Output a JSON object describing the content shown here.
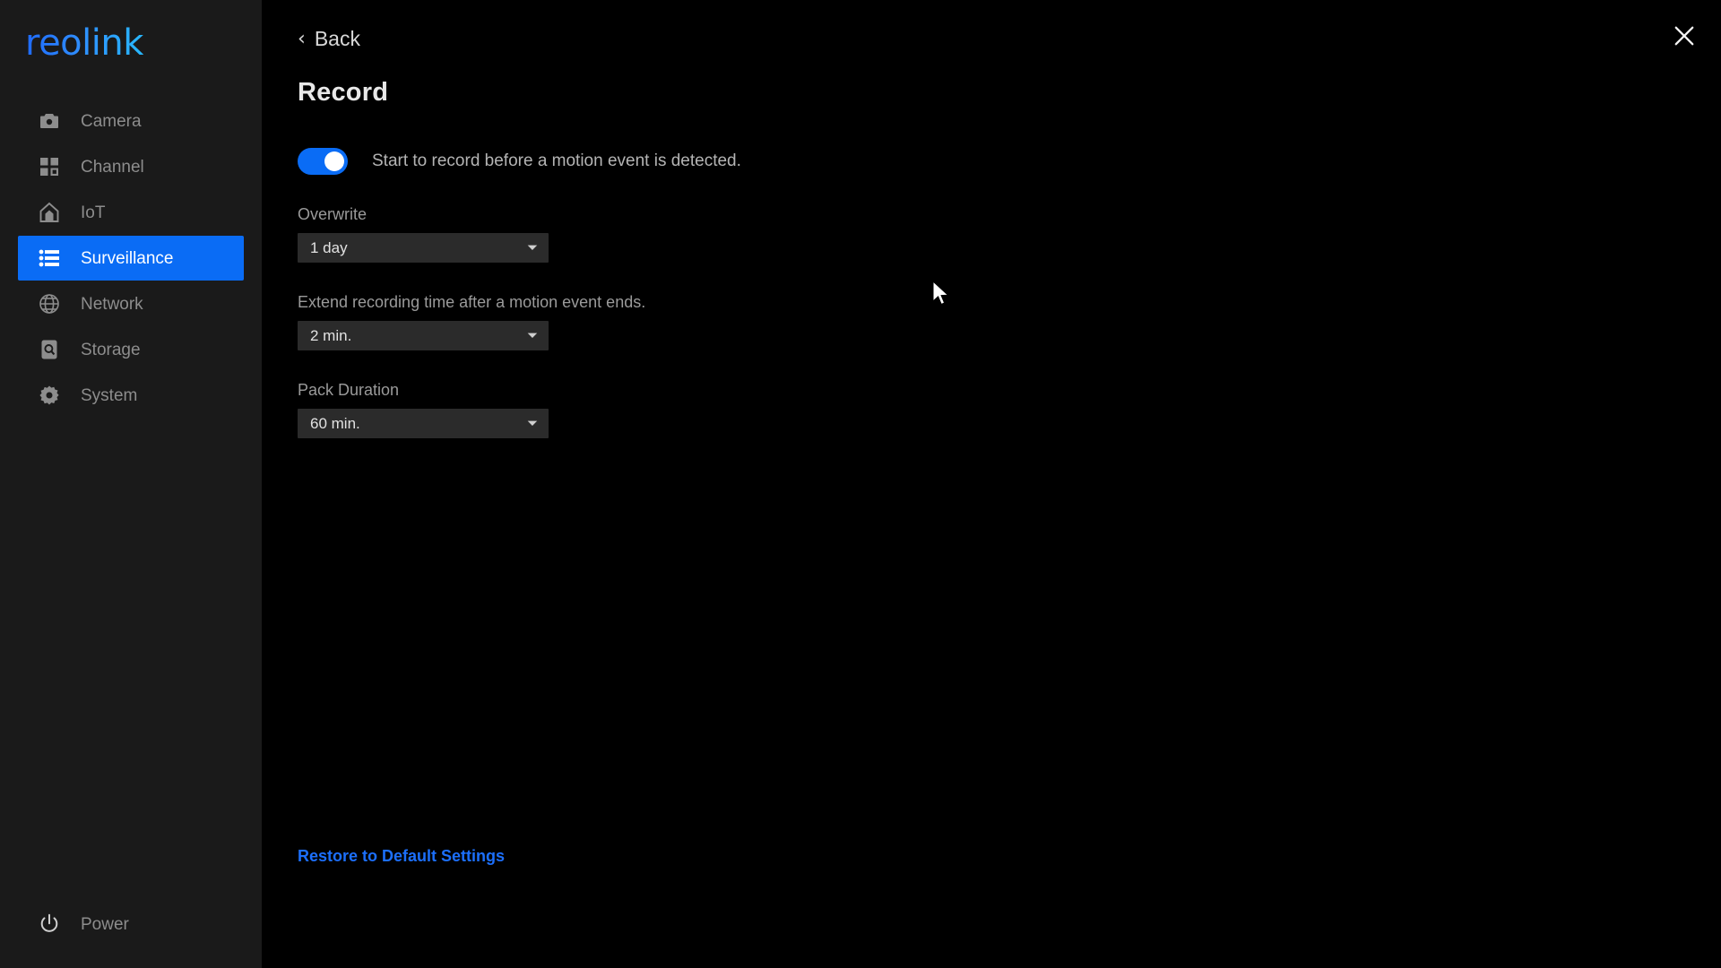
{
  "brand": {
    "logo_text": "reolink"
  },
  "sidebar": {
    "items": [
      {
        "label": "Camera",
        "icon": "camera-icon",
        "active": false
      },
      {
        "label": "Channel",
        "icon": "grid-icon",
        "active": false
      },
      {
        "label": "IoT",
        "icon": "home-icon",
        "active": false
      },
      {
        "label": "Surveillance",
        "icon": "list-icon",
        "active": true
      },
      {
        "label": "Network",
        "icon": "globe-icon",
        "active": false
      },
      {
        "label": "Storage",
        "icon": "harddrive-icon",
        "active": false
      },
      {
        "label": "System",
        "icon": "gear-icon",
        "active": false
      }
    ],
    "power": {
      "label": "Power",
      "icon": "power-icon"
    }
  },
  "header": {
    "back_label": "Back",
    "back_icon": "chevron-left-icon",
    "close_icon": "close-icon",
    "title": "Record"
  },
  "main": {
    "pre_record_toggle": {
      "label": "Start to record before a motion event is detected.",
      "enabled": true
    },
    "fields": [
      {
        "label": "Overwrite",
        "value": "1 day",
        "icon": "chevron-down-icon"
      },
      {
        "label": "Extend recording time after a motion event ends.",
        "value": "2 min.",
        "icon": "chevron-down-icon"
      },
      {
        "label": "Pack Duration",
        "value": "60 min.",
        "icon": "chevron-down-icon"
      }
    ],
    "restore_link": "Restore to Default Settings"
  },
  "colors": {
    "accent": "#0a6cf5",
    "link": "#1c6ffb",
    "sidebar_bg": "#1a1a1a",
    "main_bg": "#000000",
    "select_bg": "#2b2b2b"
  }
}
